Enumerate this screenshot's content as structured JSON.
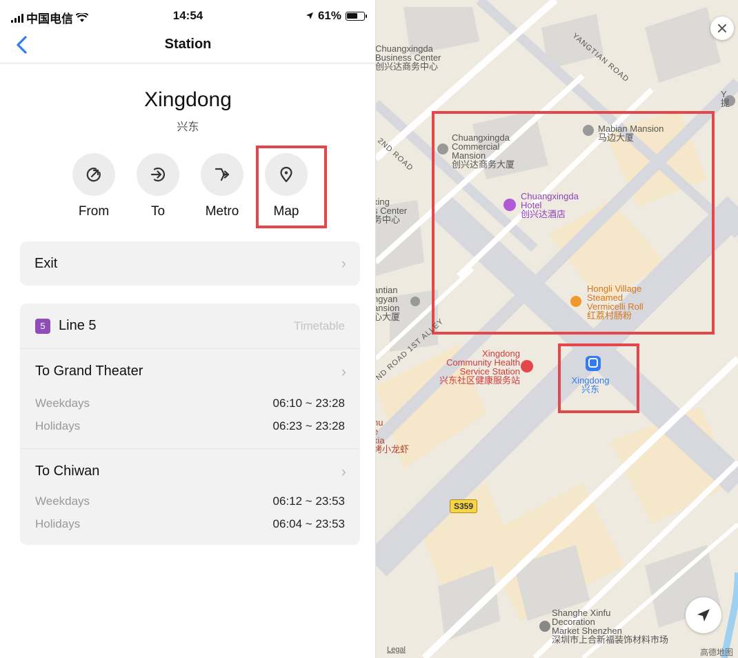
{
  "status_bar": {
    "carrier": "中国电信",
    "time": "14:54",
    "battery": "61%"
  },
  "nav": {
    "title": "Station"
  },
  "station": {
    "name": "Xingdong",
    "name_cn": "兴东"
  },
  "actions": [
    {
      "label": "From",
      "icon": "arrow-up-right-circle-icon"
    },
    {
      "label": "To",
      "icon": "arrow-right-circle-icon"
    },
    {
      "label": "Metro",
      "icon": "metro-junction-icon"
    },
    {
      "label": "Map",
      "icon": "map-pin-icon"
    }
  ],
  "exit": {
    "label": "Exit"
  },
  "line": {
    "badge": "5",
    "name": "Line 5",
    "timetable": "Timetable",
    "color": "#8e4db8",
    "directions": [
      {
        "name": "To Grand Theater",
        "rows": [
          {
            "label": "Weekdays",
            "time": "06:10 ~ 23:28"
          },
          {
            "label": "Holidays",
            "time": "06:23 ~ 23:28"
          }
        ]
      },
      {
        "name": "To Chiwan",
        "rows": [
          {
            "label": "Weekdays",
            "time": "06:12 ~ 23:53"
          },
          {
            "label": "Holidays",
            "time": "06:04 ~ 23:53"
          }
        ]
      }
    ]
  },
  "map": {
    "roads": [
      "YANGTIAN ROAD",
      "2ND ROAD",
      "ND ROAD 1ST ALLEY"
    ],
    "labels": {
      "business_center": "Chuangxingda\nBusiness Center\n创兴达商务中心",
      "commercial_mansion": "Chuangxingda\nCommercial\nMansion\n创兴达商务大厦",
      "mabian": "Mabian Mansion\n马边大厦",
      "hotel": "Chuangxingda\nHotel\n创兴达酒店",
      "partial_center": "xing\ns Center\n务中心",
      "hongli": "Hongli Village\nSteamed\nVermicelli Roll\n红荔村肠粉",
      "antian": "antian\nngyan\nansion\n心大厦",
      "health": "Xingdong\nCommunity Health\nService Station\n兴东社区健康服务站",
      "station": "Xingdong\n兴东",
      "hu": "hu\ne\nxia\n烤小龙虾",
      "shanghe": "Shanghe Xinfu\nDecoration\nMarket Shenzhen\n深圳市上合新福装饰材料市场",
      "top_right": "Y\n提"
    },
    "shield": "S359",
    "legal": "Legal",
    "attribution": "高德地图"
  },
  "colors": {
    "accent": "#2f7cf6",
    "highlight": "#e3474a",
    "metro_line_5": "#8e4db8"
  }
}
